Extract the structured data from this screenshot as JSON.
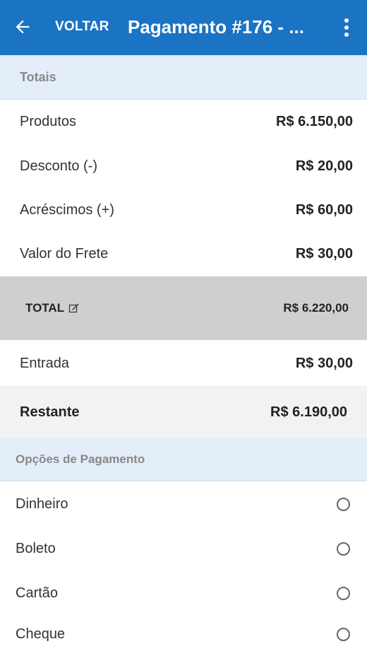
{
  "appbar": {
    "back_label": "VOLTAR",
    "title": "Pagamento #176 - ..."
  },
  "totais": {
    "header": "Totais",
    "rows": [
      {
        "label": "Produtos",
        "value": "R$ 6.150,00"
      },
      {
        "label": "Desconto (-)",
        "value": "R$ 20,00"
      },
      {
        "label": "Acréscimos (+)",
        "value": "R$ 60,00"
      },
      {
        "label": "Valor do Frete",
        "value": "R$ 30,00"
      }
    ],
    "total_label": "TOTAL",
    "total_value": "R$ 6.220,00",
    "entrada_label": "Entrada",
    "entrada_value": "R$ 30,00",
    "restante_label": "Restante",
    "restante_value": "R$ 6.190,00"
  },
  "opcoes": {
    "header": "Opções de Pagamento",
    "items": [
      {
        "label": "Dinheiro"
      },
      {
        "label": "Boleto"
      },
      {
        "label": "Cartão"
      },
      {
        "label": "Cheque"
      }
    ]
  },
  "colors": {
    "primary": "#1b73c3",
    "section_header_bg": "#e3eef9",
    "total_bg": "#cfcfcf"
  }
}
